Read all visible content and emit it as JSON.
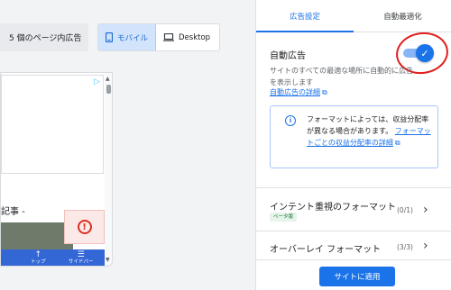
{
  "left": {
    "ad_count_label": "5 個のページ内広告",
    "device_toggle": {
      "mobile_label": "モバイル",
      "desktop_label": "Desktop"
    },
    "preview": {
      "article_snippet": "記事 -",
      "nav": {
        "top_label": "トップ",
        "sidebar_label": "サイドバー"
      }
    }
  },
  "panel": {
    "tabs": [
      {
        "label": "広告設定"
      },
      {
        "label": "自動最適化"
      }
    ],
    "auto_ads": {
      "title": "自動広告",
      "enabled": true,
      "description": "サイトのすべての最適な場所に自動的に広告を表示します",
      "link": "自動広告の詳細"
    },
    "info": {
      "text": "フォーマットによっては、収益分配率が異なる場合があります。",
      "link": "フォーマットごとの収益分配率の詳細"
    },
    "sections": [
      {
        "title": "インテント重視のフォーマット",
        "badge": "ベータ版",
        "count": "(0/1)"
      },
      {
        "title": "オーバーレイ フォーマット",
        "count": "(3/3)"
      }
    ],
    "apply_button": "サイトに適用"
  },
  "colors": {
    "accent": "#1a73e8",
    "annotation": "#e01f1f",
    "warning": "#d93025"
  }
}
